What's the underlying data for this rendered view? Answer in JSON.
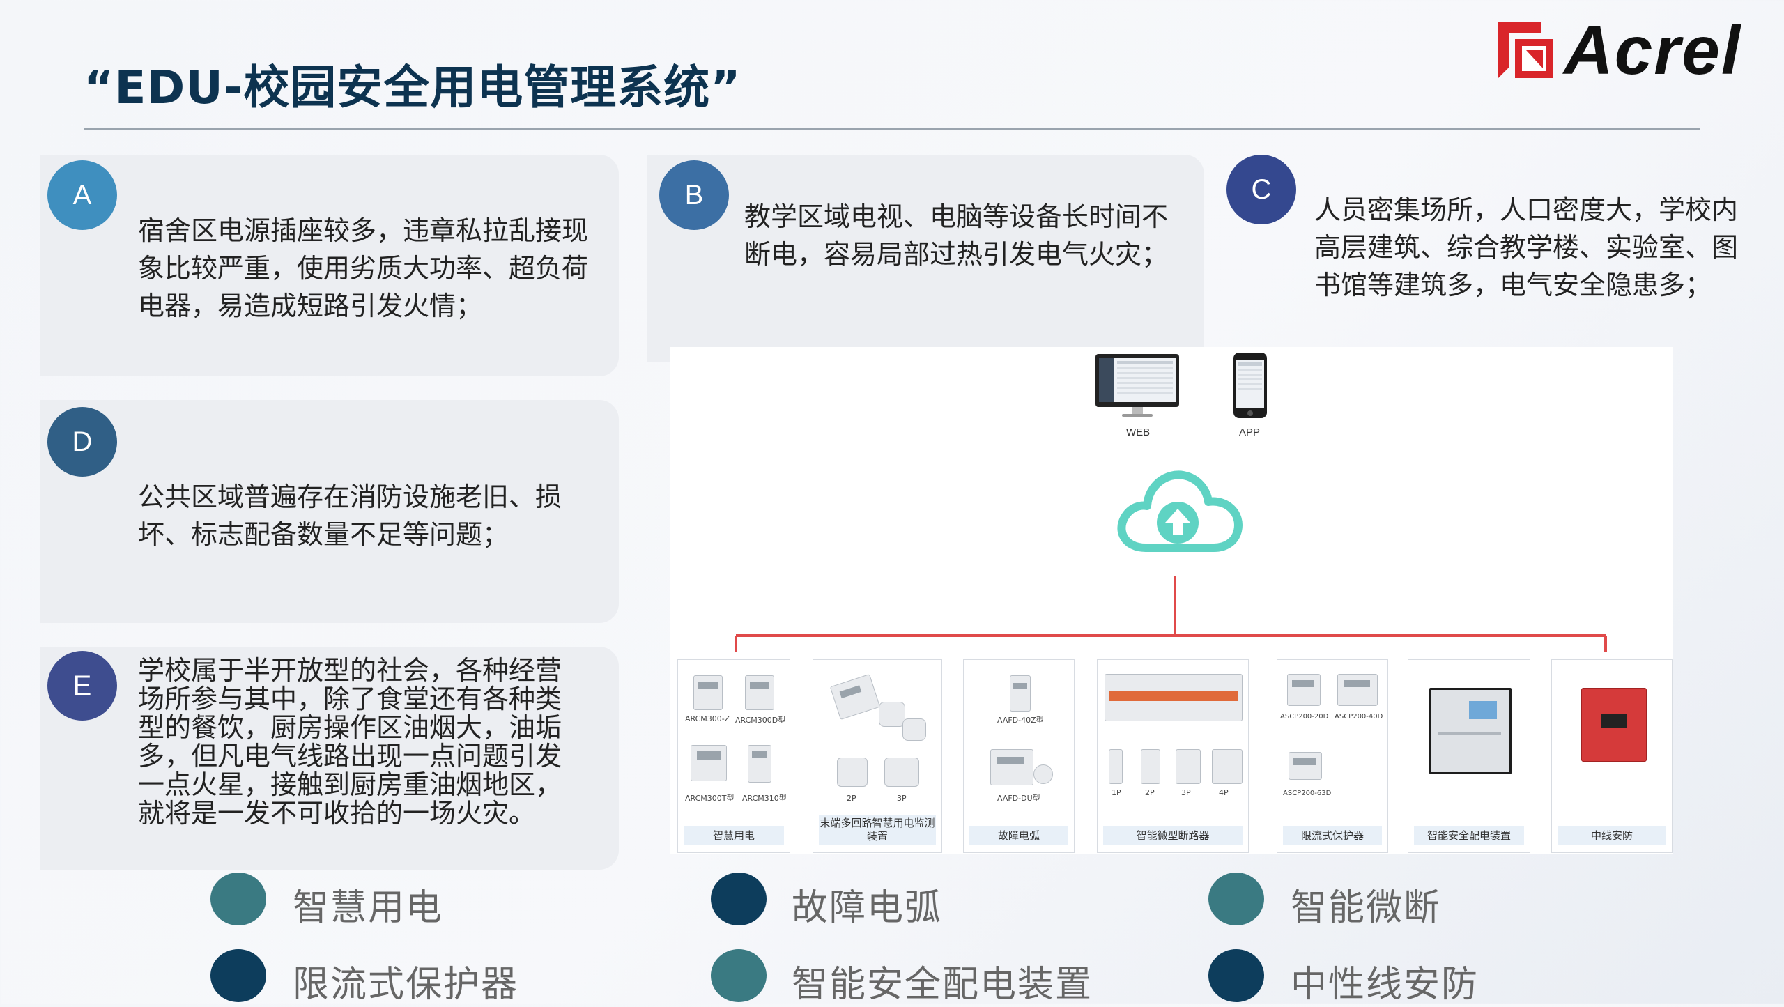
{
  "header": {
    "title": "“EDU-校园安全用电管理系统”",
    "logo_text": "Acrel"
  },
  "colors": {
    "badge_a": "#3f8fbf",
    "badge_b": "#3c6fa4",
    "badge_c": "#34488f",
    "badge_d": "#305f86",
    "badge_e": "#3e4d8f",
    "legend_teal": "#3a7a82",
    "legend_navy": "#0d3d5c",
    "accent_red": "#e04a4a",
    "cloud_teal": "#5fd3c3"
  },
  "cards": [
    {
      "letter": "A",
      "text": "宿舍区电源插座较多，违章私拉乱接现象比较严重，使用劣质大功率、超负荷电器，易造成短路引发火情；"
    },
    {
      "letter": "B",
      "text": "教学区域电视、电脑等设备长时间不断电，容易局部过热引发电气火灾；"
    },
    {
      "letter": "C",
      "text": "人员密集场所，人口密度大，学校内高层建筑、综合教学楼、实验室、图书馆等建筑多，电气安全隐患多；"
    },
    {
      "letter": "D",
      "text": "公共区域普遍存在消防设施老旧、损坏、标志配备数量不足等问题；"
    },
    {
      "letter": "E",
      "text": "学校属于半开放型的社会，各种经营场所参与其中，除了食堂还有各种类型的餐饮，厨房操作区油烟大，油垢多，但凡电气线路出现一点问题引发一点火星，接触到厨房重油烟地区，就将是一发不可收拾的一场火灾。"
    }
  ],
  "diagram": {
    "web_label": "WEB",
    "app_label": "APP",
    "products": [
      {
        "label": "智慧用电",
        "models": [
          "ARCM300-Z",
          "ARCM300D型",
          "ARCM300T型",
          "ARCM310型"
        ]
      },
      {
        "label": "末端多回路智慧用电监测装置",
        "models": [
          "2P",
          "3P"
        ]
      },
      {
        "label": "故障电弧",
        "models": [
          "AAFD-40Z型",
          "AAFD-DU型"
        ]
      },
      {
        "label": "智能微型断路器",
        "models": [
          "1P",
          "2P",
          "3P",
          "4P"
        ]
      },
      {
        "label": "限流式保护器",
        "models": [
          "ASCP200-20D",
          "ASCP200-40D",
          "ASCP200-63D"
        ]
      },
      {
        "label": "智能安全配电装置",
        "models": []
      },
      {
        "label": "中线安防",
        "models": []
      }
    ]
  },
  "legend": [
    {
      "label": "智慧用电",
      "color": "teal"
    },
    {
      "label": "故障电弧",
      "color": "navy"
    },
    {
      "label": "智能微断",
      "color": "teal"
    },
    {
      "label": "限流式保护器",
      "color": "navy"
    },
    {
      "label": "智能安全配电装置",
      "color": "teal"
    },
    {
      "label": "中性线安防",
      "color": "navy"
    }
  ]
}
